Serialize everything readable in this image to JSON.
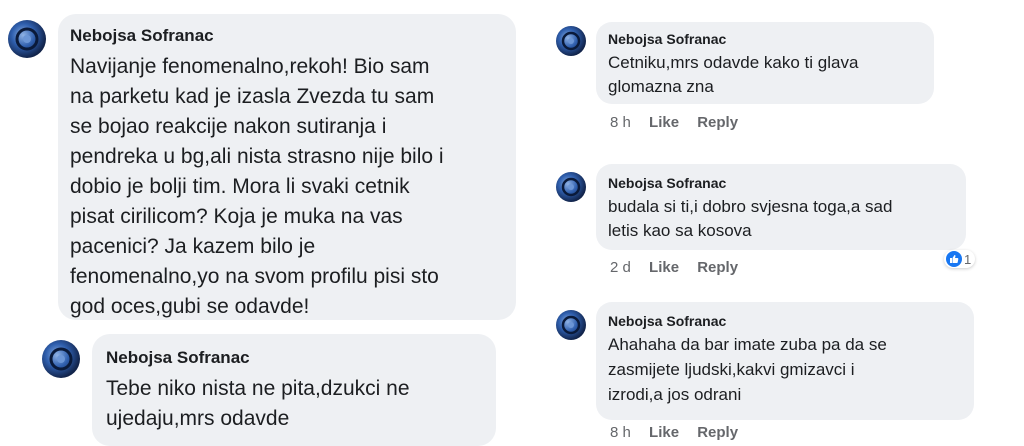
{
  "comments": [
    {
      "author": "Nebojsa Sofranac",
      "lines": [
        "Navijanje fenomenalno,rekoh! Bio sam",
        "na parketu kad je izasla Zvezda tu sam",
        "se bojao reakcije nakon sutiranja i",
        "pendreka u bg,ali nista strasno nije bilo i",
        "dobio je bolji tim. Mora li svaki cetnik",
        "pisat cirilicom? Koja je muka na vas",
        "pacenici? Ja kazem bilo je",
        "fenomenalno,yo na svom profilu pisi sto",
        "god oces,gubi se odavde!"
      ]
    },
    {
      "author": "Nebojsa Sofranac",
      "lines": [
        "Tebe niko nista ne pita,dzukci ne",
        "ujedaju,mrs odavde"
      ]
    },
    {
      "author": "Nebojsa Sofranac",
      "lines": [
        "Cetniku,mrs odavde kako ti glava",
        "glomazna zna"
      ],
      "time": "8 h",
      "like": "Like",
      "reply": "Reply"
    },
    {
      "author": "Nebojsa Sofranac",
      "lines": [
        "budala si ti,i dobro svjesna toga,a sad",
        "letis kao sa kosova"
      ],
      "time": "2 d",
      "like": "Like",
      "reply": "Reply",
      "reaction_count": "1"
    },
    {
      "author": "Nebojsa Sofranac",
      "lines": [
        "Ahahaha da bar imate zuba pa da se",
        "zasmijete ljudski,kakvi gmizavci i",
        "izrodi,a jos odrani"
      ],
      "time": "8 h",
      "like": "Like",
      "reply": "Reply"
    }
  ],
  "colors": {
    "bubble": "#eef0f3",
    "meta_text": "#65676b",
    "like_blue": "#1877f2"
  },
  "icons": {
    "avatar": "avatar-image",
    "reaction": "like-thumb-icon"
  }
}
